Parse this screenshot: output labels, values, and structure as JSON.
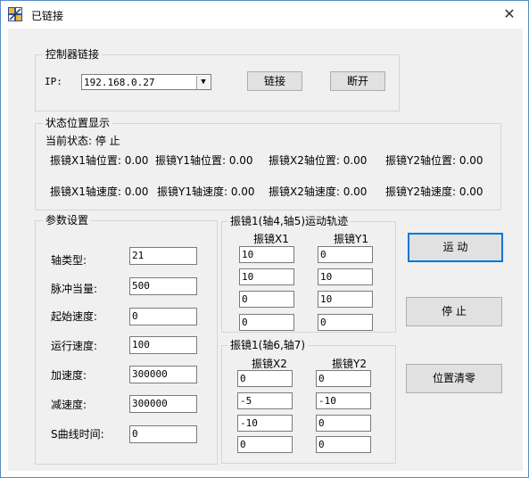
{
  "window": {
    "title": "已链接",
    "close_symbol": "✕"
  },
  "controller": {
    "group_title": "控制器链接",
    "ip_label": "IP:",
    "ip_value": "192.168.0.27",
    "connect_label": "链接",
    "disconnect_label": "断开"
  },
  "status": {
    "group_title": "状态位置显示",
    "current_state": "当前状态: 停  止",
    "pos_x1": "振镜X1轴位置: 0.00",
    "pos_y1": "振镜Y1轴位置: 0.00",
    "pos_x2": "振镜X2轴位置: 0.00",
    "pos_y2": "振镜Y2轴位置: 0.00",
    "spd_x1": "振镜X1轴速度: 0.00",
    "spd_y1": "振镜Y1轴速度: 0.00",
    "spd_x2": "振镜X2轴速度: 0.00",
    "spd_y2": "振镜Y2轴速度: 0.00"
  },
  "params": {
    "group_title": "参数设置",
    "rows": [
      {
        "label": "轴类型:",
        "value": "21"
      },
      {
        "label": "脉冲当量:",
        "value": "500"
      },
      {
        "label": "起始速度:",
        "value": "0"
      },
      {
        "label": "运行速度:",
        "value": "100"
      },
      {
        "label": "加速度:",
        "value": "300000"
      },
      {
        "label": "减速度:",
        "value": "300000"
      },
      {
        "label": "S曲线时间:",
        "value": "0"
      }
    ]
  },
  "track1": {
    "group_title": "振镜1(轴4,轴5)运动轨迹",
    "col_x": "振镜X1",
    "col_y": "振镜Y1",
    "x": [
      "10",
      "10",
      "0",
      "0"
    ],
    "y": [
      "0",
      "10",
      "10",
      "0"
    ]
  },
  "track2": {
    "group_title": "振镜1(轴6,轴7)",
    "col_x": "振镜X2",
    "col_y": "振镜Y2",
    "x": [
      "0",
      "-5",
      "-10",
      "0"
    ],
    "y": [
      "0",
      "-10",
      "0",
      "0"
    ]
  },
  "actions": {
    "run_label": "运  动",
    "stop_label": "停  止",
    "zero_label": "位置清零"
  }
}
